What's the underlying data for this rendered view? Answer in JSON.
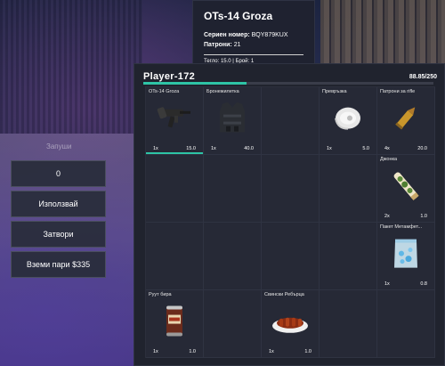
{
  "background": {
    "label": "Запуши"
  },
  "tooltip": {
    "title": "OTs-14 Groza",
    "serial_label": "Сериен номер:",
    "serial_value": "BQY879KUX",
    "ammo_label": "Патрони:",
    "ammo_value": "21",
    "footer": "Тегло: 15.0 | Брой: 1"
  },
  "actions": {
    "amount": "0",
    "use": "Използвай",
    "close": "Затвори",
    "take_money": "Вземи пари $335"
  },
  "inventory": {
    "player": "Player-172",
    "weight": "88.85/250",
    "weight_fill_fraction": 0.355,
    "accent": "#2ec4a6",
    "slots": [
      {
        "label": "OTs-14 Groza",
        "qty": "1x",
        "weight": "15.0",
        "icon": "rifle-icon",
        "durability": true
      },
      {
        "label": "Бронежилетка",
        "qty": "1x",
        "weight": "40.0",
        "icon": "vest-icon",
        "durability": false
      },
      {
        "label": "",
        "qty": "",
        "weight": "",
        "icon": "",
        "durability": false
      },
      {
        "label": "Превръзка",
        "qty": "1x",
        "weight": "5.0",
        "icon": "bandage-icon",
        "durability": false
      },
      {
        "label": "Патрони за rifle",
        "qty": "4x",
        "weight": "20.0",
        "icon": "bullet-icon",
        "durability": false
      },
      {
        "label": "",
        "qty": "",
        "weight": "",
        "icon": "",
        "durability": false
      },
      {
        "label": "",
        "qty": "",
        "weight": "",
        "icon": "",
        "durability": false
      },
      {
        "label": "",
        "qty": "",
        "weight": "",
        "icon": "",
        "durability": false
      },
      {
        "label": "",
        "qty": "",
        "weight": "",
        "icon": "",
        "durability": false
      },
      {
        "label": "Джонка",
        "qty": "2x",
        "weight": "1.0",
        "icon": "joint-icon",
        "durability": false
      },
      {
        "label": "",
        "qty": "",
        "weight": "",
        "icon": "",
        "durability": false
      },
      {
        "label": "",
        "qty": "",
        "weight": "",
        "icon": "",
        "durability": false
      },
      {
        "label": "",
        "qty": "",
        "weight": "",
        "icon": "",
        "durability": false
      },
      {
        "label": "",
        "qty": "",
        "weight": "",
        "icon": "",
        "durability": false
      },
      {
        "label": "Пакет Метамфет...",
        "qty": "1x",
        "weight": "0.8",
        "icon": "meth-bag-icon",
        "durability": false
      },
      {
        "label": "Руут бира",
        "qty": "1x",
        "weight": "1.0",
        "icon": "can-icon",
        "durability": false
      },
      {
        "label": "",
        "qty": "",
        "weight": "",
        "icon": "",
        "durability": false
      },
      {
        "label": "Свински Ребърца",
        "qty": "1x",
        "weight": "1.0",
        "icon": "ribs-icon",
        "durability": false
      },
      {
        "label": "",
        "qty": "",
        "weight": "",
        "icon": "",
        "durability": false
      },
      {
        "label": "",
        "qty": "",
        "weight": "",
        "icon": "",
        "durability": false
      }
    ]
  }
}
